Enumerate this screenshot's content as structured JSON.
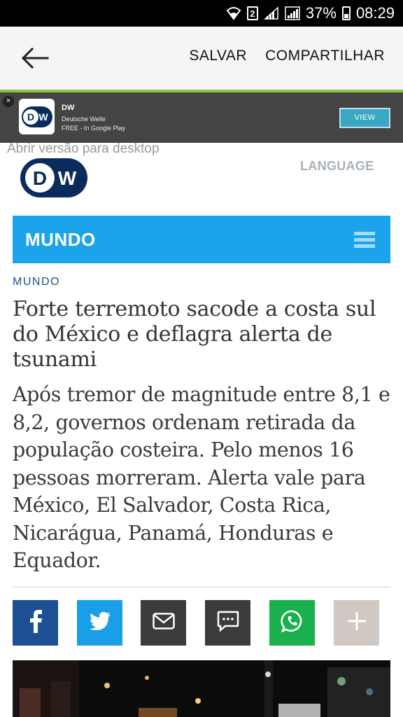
{
  "status_bar": {
    "sim": "2",
    "battery": "37%",
    "time": "08:29"
  },
  "app_bar": {
    "save_label": "SALVAR",
    "share_label": "COMPARTILHAR"
  },
  "ad": {
    "logo_text": "DW",
    "title": "DW",
    "publisher": "Deutsche Welle",
    "price": "FREE - In Google Play",
    "cta": "VIEW"
  },
  "page": {
    "desktop_link": "Abrir versão para desktop",
    "logo_text": "DW",
    "language_label": "LANGUAGE",
    "section_title": "MUNDO",
    "kicker": "MUNDO",
    "headline": "Forte terremoto sacode a costa sul do México e deflagra alerta de tsunami",
    "lead": "Após tremor de magnitude entre 8,1 e 8,2, governos ordenam retirada da população costeira. Pelo menos 16 pessoas morreram. Alerta vale para México, El Salvador, Costa Rica, Nicarágua, Panamá, Honduras e Equador."
  },
  "share_buttons": [
    {
      "name": "facebook",
      "icon": "facebook-icon",
      "color": "#1d4f93"
    },
    {
      "name": "twitter",
      "icon": "twitter-icon",
      "color": "#1a9ee8"
    },
    {
      "name": "email",
      "icon": "mail-icon",
      "color": "#3b3b3b"
    },
    {
      "name": "sms",
      "icon": "message-icon",
      "color": "#3b3b3b"
    },
    {
      "name": "whatsapp",
      "icon": "whatsapp-icon",
      "color": "#1ab04d"
    },
    {
      "name": "more",
      "icon": "plus-icon",
      "color": "#d0c8c2"
    }
  ],
  "colors": {
    "accent": "#1ba3ec",
    "brand_dark": "#0a2c5c",
    "app_bar_line": "#8bc34a"
  }
}
